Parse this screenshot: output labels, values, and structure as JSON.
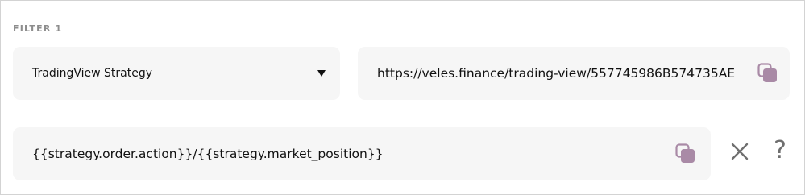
{
  "filter": {
    "label": "FILTER 1",
    "strategy_select": {
      "selected": "TradingView Strategy",
      "icon": "chevron-down-icon"
    },
    "webhook_url": {
      "value": "https://veles.finance/trading-view/557745986B574735AE",
      "copy_icon": "copy-icon"
    },
    "condition": {
      "value": "{{strategy.order.action}}/{{strategy.market_position}}",
      "copy_icon": "copy-icon"
    },
    "actions": {
      "remove_icon": "close-icon",
      "help_label": "?"
    }
  },
  "colors": {
    "field_bg": "#f6f6f6",
    "text": "#111111",
    "label": "#8d8d8d",
    "copy_icon_fill": "#a98aa6",
    "icon_gray": "#6f6f6f",
    "border": "#d3d3d3"
  }
}
